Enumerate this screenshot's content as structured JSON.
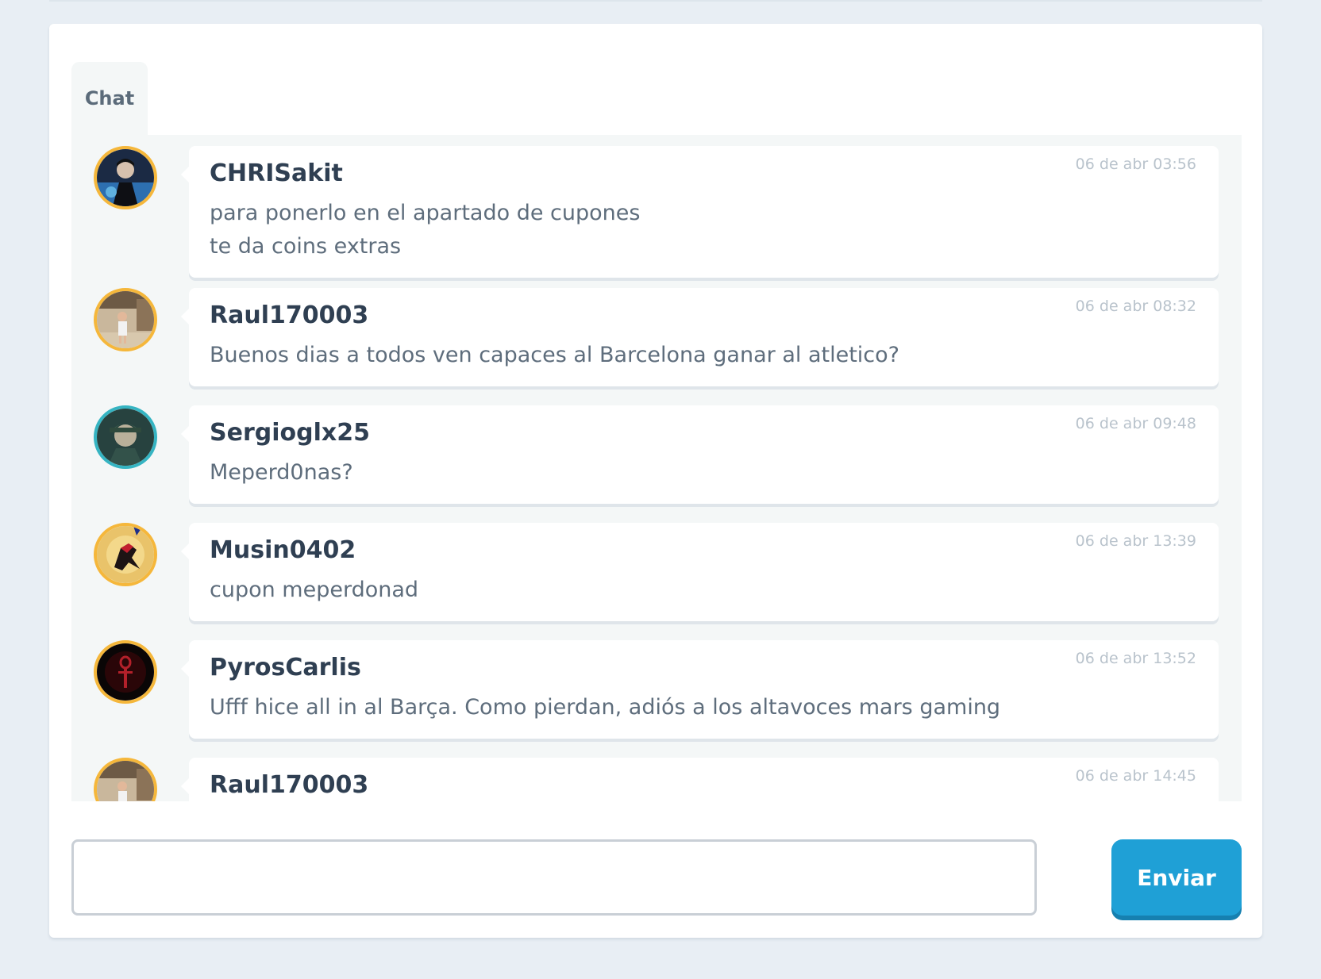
{
  "chat": {
    "tab_label": "Chat",
    "messages": [
      {
        "user": "CHRISakit",
        "time": "06 de abr 03:56",
        "text": "para ponerlo en el apartado de cupones\nte da coins extras",
        "avatar": "avatar-dark-portrait"
      },
      {
        "user": "Raul170003",
        "time": "06 de abr 08:32",
        "text": "Buenos dias a todos ven capaces al Barcelona ganar al atletico?",
        "avatar": "avatar-child-photo"
      },
      {
        "user": "Sergioglx25",
        "time": "06 de abr 09:48",
        "text": "Meperd0nas?",
        "avatar": "avatar-soldier-art"
      },
      {
        "user": "Musin0402",
        "time": "06 de abr 13:39",
        "text": "cupon meperdonad",
        "avatar": "avatar-spider-hero"
      },
      {
        "user": "PyrosCarlis",
        "time": "06 de abr 13:52",
        "text": "Ufff hice all in al Barça. Como pierdan, adiós a los altavoces mars gaming",
        "avatar": "avatar-red-ankh"
      },
      {
        "user": "Raul170003",
        "time": "06 de abr 14:45",
        "text": "",
        "avatar": "avatar-child-photo"
      }
    ]
  },
  "composer": {
    "value": "",
    "placeholder": "",
    "send_label": "Enviar"
  },
  "colors": {
    "page_bg": "#e8eef4",
    "accent": "#1fa0d6",
    "avatar_ring_gold": "#f5b73b",
    "avatar_ring_teal": "#35b4c2"
  }
}
